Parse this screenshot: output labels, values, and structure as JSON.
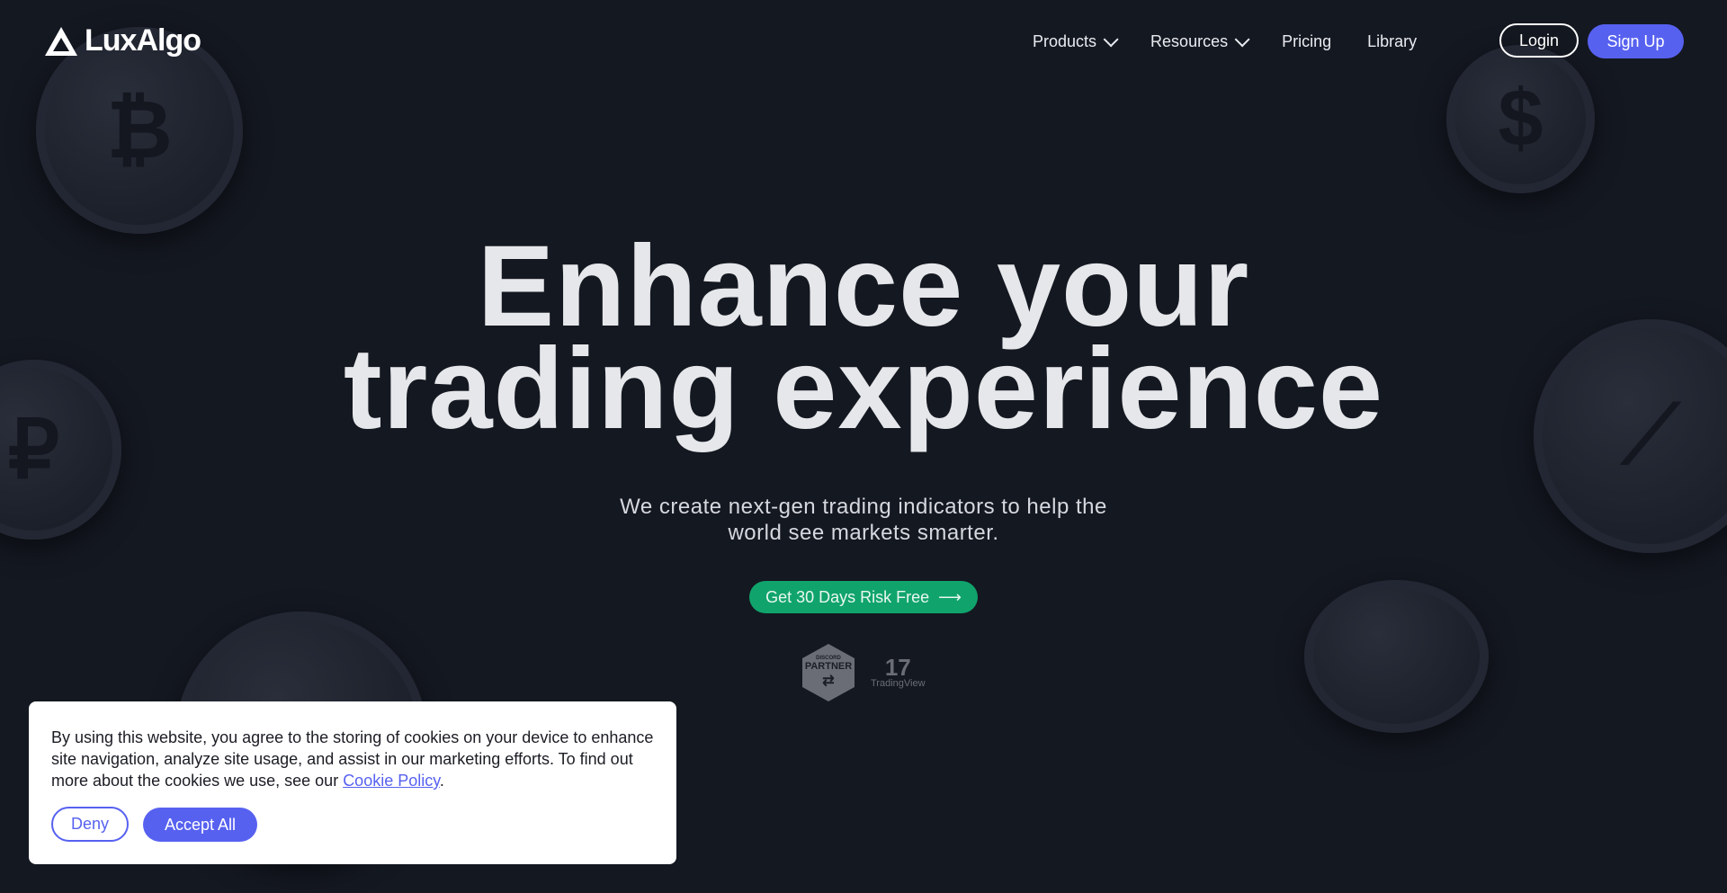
{
  "brand": {
    "name": "LuxAlgo"
  },
  "nav": {
    "items": [
      {
        "label": "Products",
        "has_dropdown": true
      },
      {
        "label": "Resources",
        "has_dropdown": true
      },
      {
        "label": "Pricing",
        "has_dropdown": false
      },
      {
        "label": "Library",
        "has_dropdown": false
      }
    ],
    "login": "Login",
    "signup": "Sign Up"
  },
  "hero": {
    "title_line1": "Enhance your",
    "title_line2": "trading experience",
    "subtitle_line1": "We create next-gen trading indicators to help the",
    "subtitle_line2": "world see markets smarter.",
    "cta": "Get 30 Days Risk Free",
    "cta_icon": "arrow-right-icon"
  },
  "badges": {
    "discord_small": "DISCORD",
    "discord_big": "PARTNER",
    "tradingview_mark": "17",
    "tradingview_name": "TradingView"
  },
  "cookie_banner": {
    "text": "By using this website, you agree to the storing of cookies on your device to enhance site navigation, analyze site usage, and assist in our marketing efforts. To find out more about the cookies we use, see our ",
    "link": "Cookie Policy",
    "after_link": ".",
    "deny": "Deny",
    "accept": "Accept All"
  },
  "colors": {
    "accent": "#5761f0",
    "cta": "#10a46c",
    "background": "#141821"
  }
}
